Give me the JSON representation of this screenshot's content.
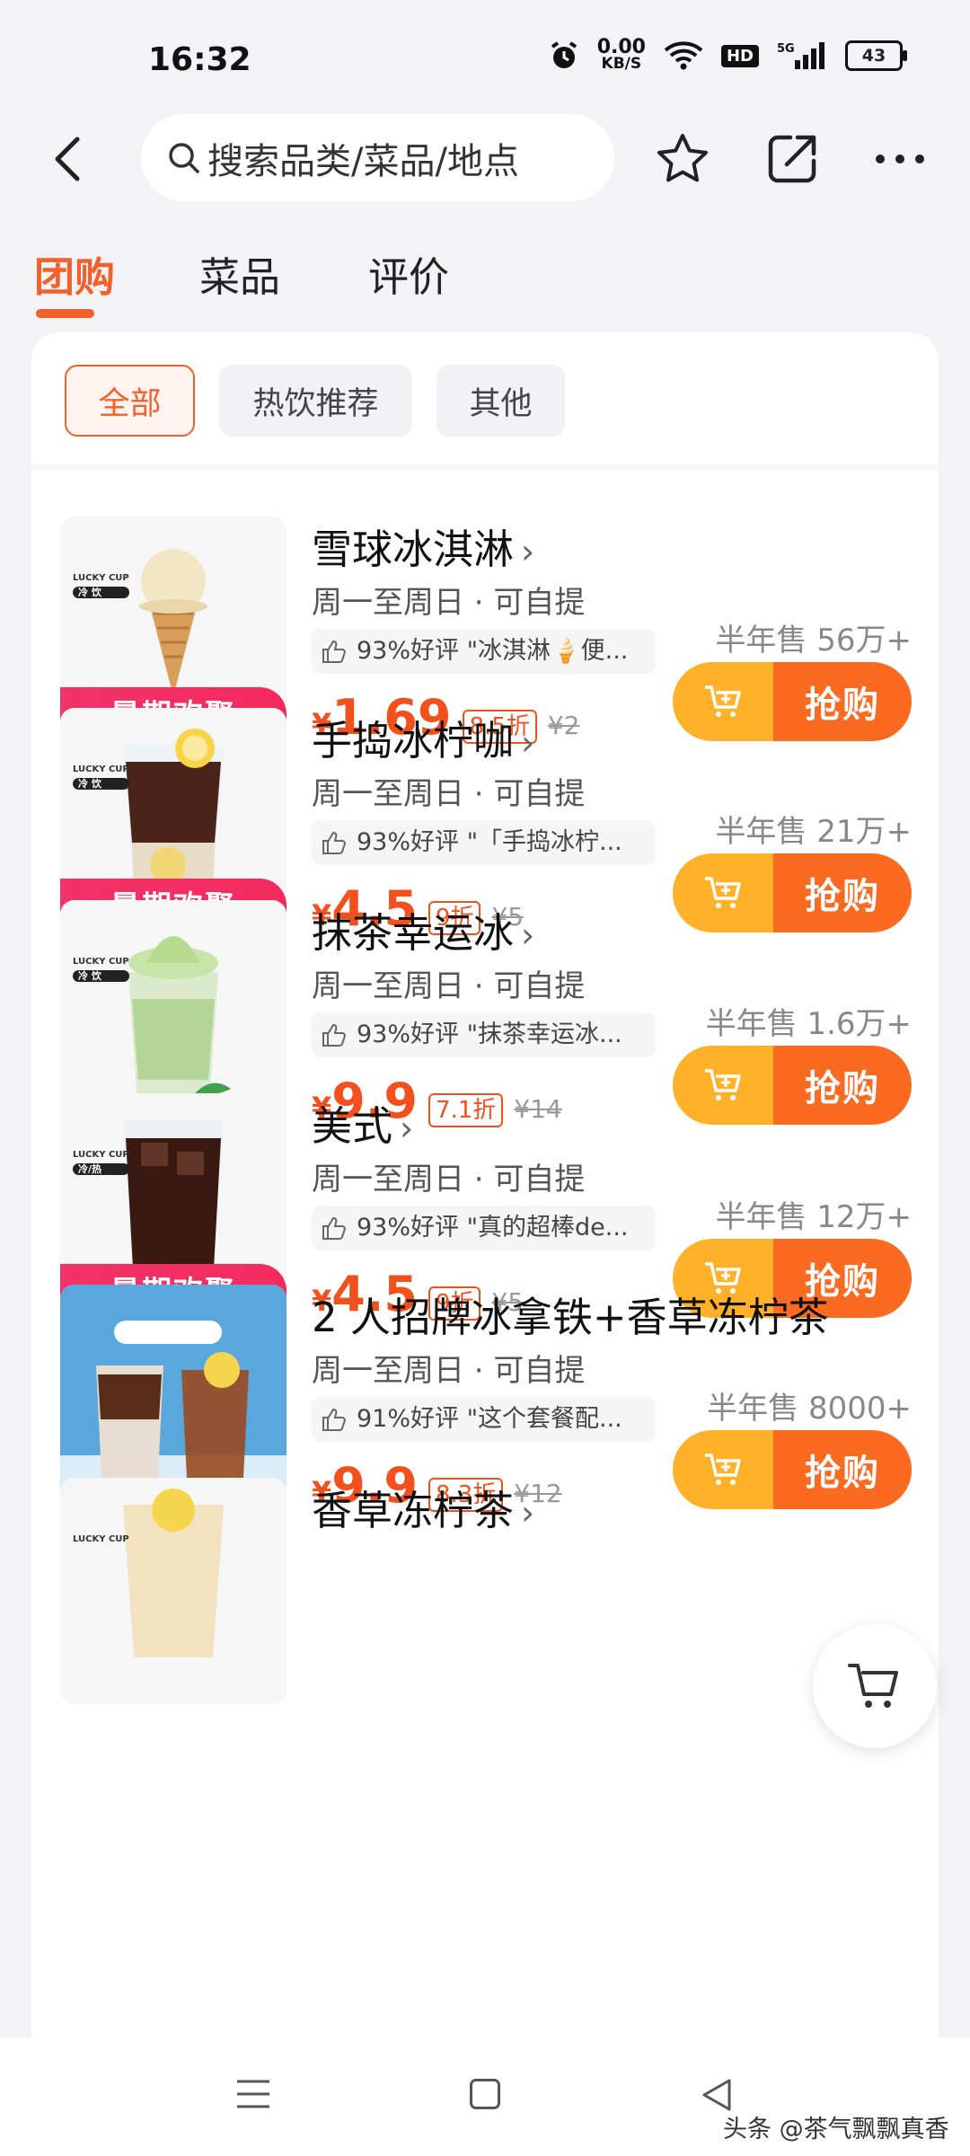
{
  "status_bar": {
    "time": "16:32",
    "net_speed": "0.00",
    "net_unit": "KB/S",
    "hd": "HD",
    "signal": "5G",
    "battery": "43"
  },
  "top_bar": {
    "search_placeholder": "搜索品类/菜品/地点"
  },
  "tabs": [
    {
      "label": "团购",
      "active": true
    },
    {
      "label": "菜品",
      "active": false
    },
    {
      "label": "评价",
      "active": false
    }
  ],
  "filters": [
    {
      "label": "全部",
      "active": true
    },
    {
      "label": "热饮推荐",
      "active": false
    },
    {
      "label": "其他",
      "active": false
    }
  ],
  "products": [
    {
      "name": "雪球冰淇淋",
      "meta": "周一至周日 · 可自提",
      "review": "93%好评 \"冰淇淋🍦便...",
      "price": "1.69",
      "discount": "8.5折",
      "original": "¥2",
      "sold": "半年售 56万+",
      "tag": "暑期欢聚",
      "badge": "冷 饮"
    },
    {
      "name": "手捣冰柠咖",
      "meta": "周一至周日 · 可自提",
      "review": "93%好评 \"「手捣冰柠...",
      "price": "4.5",
      "discount": "9折",
      "original": "¥5",
      "sold": "半年售 21万+",
      "tag": "暑期欢聚",
      "badge": "冷 饮"
    },
    {
      "name": "抹茶幸运冰",
      "meta": "周一至周日 · 可自提",
      "review": "93%好评 \"抹茶幸运冰...",
      "price": "9.9",
      "discount": "7.1折",
      "original": "¥14",
      "sold": "半年售 1.6万+",
      "tag": "",
      "badge": "冷 饮"
    },
    {
      "name": "美式",
      "meta": "周一至周日 · 可自提",
      "review": "93%好评 \"真的超棒de...",
      "price": "4.5",
      "discount": "9折",
      "original": "¥5",
      "sold": "半年售 12万+",
      "tag": "暑期欢聚",
      "badge": "冷/热"
    },
    {
      "name": "2 人招牌冰拿铁+香草冻柠茶",
      "meta": "周一至周日 · 可自提",
      "review": "91%好评 \"这个套餐配...",
      "price": "9.9",
      "discount": "8.3折",
      "original": "¥12",
      "sold": "半年售 8000+",
      "tag": "",
      "badge": ""
    },
    {
      "name": "香草冻柠茶",
      "meta": "",
      "review": "",
      "price": "",
      "discount": "",
      "original": "",
      "sold": "",
      "tag": "",
      "badge": ""
    }
  ],
  "buy_label": "抢购",
  "yen": "¥",
  "lucky_label": "LUCKY CUP",
  "watermark": "头条 @茶气飘飘真香",
  "colors": {
    "accent": "#f2602b",
    "price": "#f2501c",
    "tag": "#f2336a",
    "cart_btn": "#ffb12a",
    "buy_btn": "#fb6a21"
  }
}
